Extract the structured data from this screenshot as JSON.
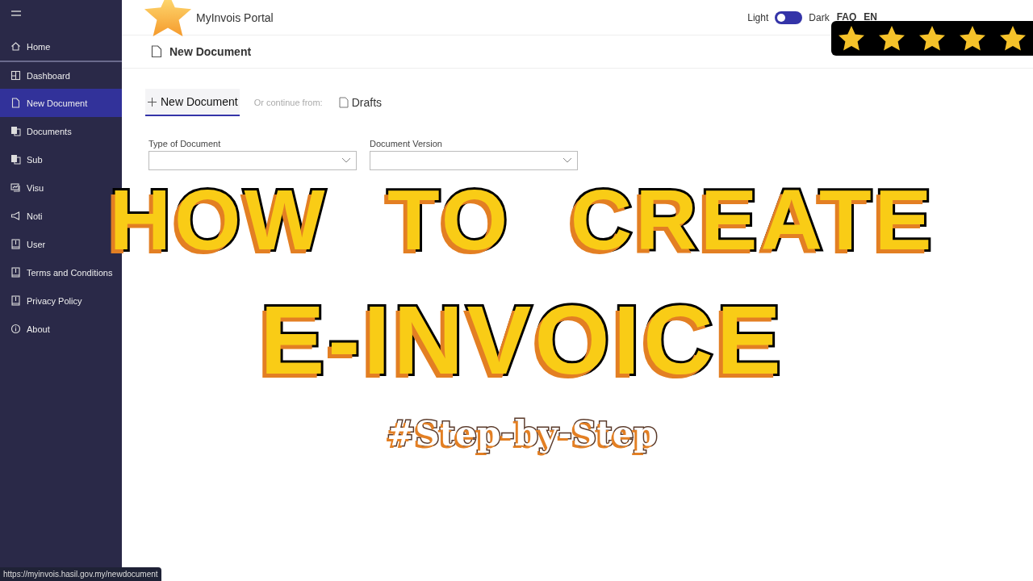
{
  "sidebar": {
    "items": [
      {
        "label": "Home",
        "selected": false
      },
      {
        "label": "Dashboard",
        "selected": false
      },
      {
        "label": "New Document",
        "selected": true
      },
      {
        "label": "Documents",
        "selected": false
      },
      {
        "label": "Sub",
        "selected": false
      },
      {
        "label": "Visu",
        "selected": false
      },
      {
        "label": "Noti",
        "selected": false
      },
      {
        "label": "User",
        "selected": false
      },
      {
        "label": "Terms and Conditions",
        "selected": false
      },
      {
        "label": "Privacy Policy",
        "selected": false
      },
      {
        "label": "About",
        "selected": false
      }
    ]
  },
  "header": {
    "title": "MyInvois Portal",
    "theme_light": "Light",
    "theme_dark": "Dark",
    "dark_on": false,
    "links": [
      "FAQ",
      "EN"
    ]
  },
  "page_title": "New Document",
  "tabs": [
    {
      "label": "New Document",
      "selected": true
    },
    {
      "label": "Drafts",
      "selected": false
    }
  ],
  "continue_label": "Or continue from:",
  "fields": [
    {
      "label": "Type of Document"
    },
    {
      "label": "Document Version"
    }
  ],
  "status_url": "https://myinvois.hasil.gov.my/newdocument",
  "overlay": {
    "lines": [
      "HOW TO CREATE",
      "E-INVOICE"
    ],
    "tag": "#Step-by-Step",
    "stars": 5
  }
}
